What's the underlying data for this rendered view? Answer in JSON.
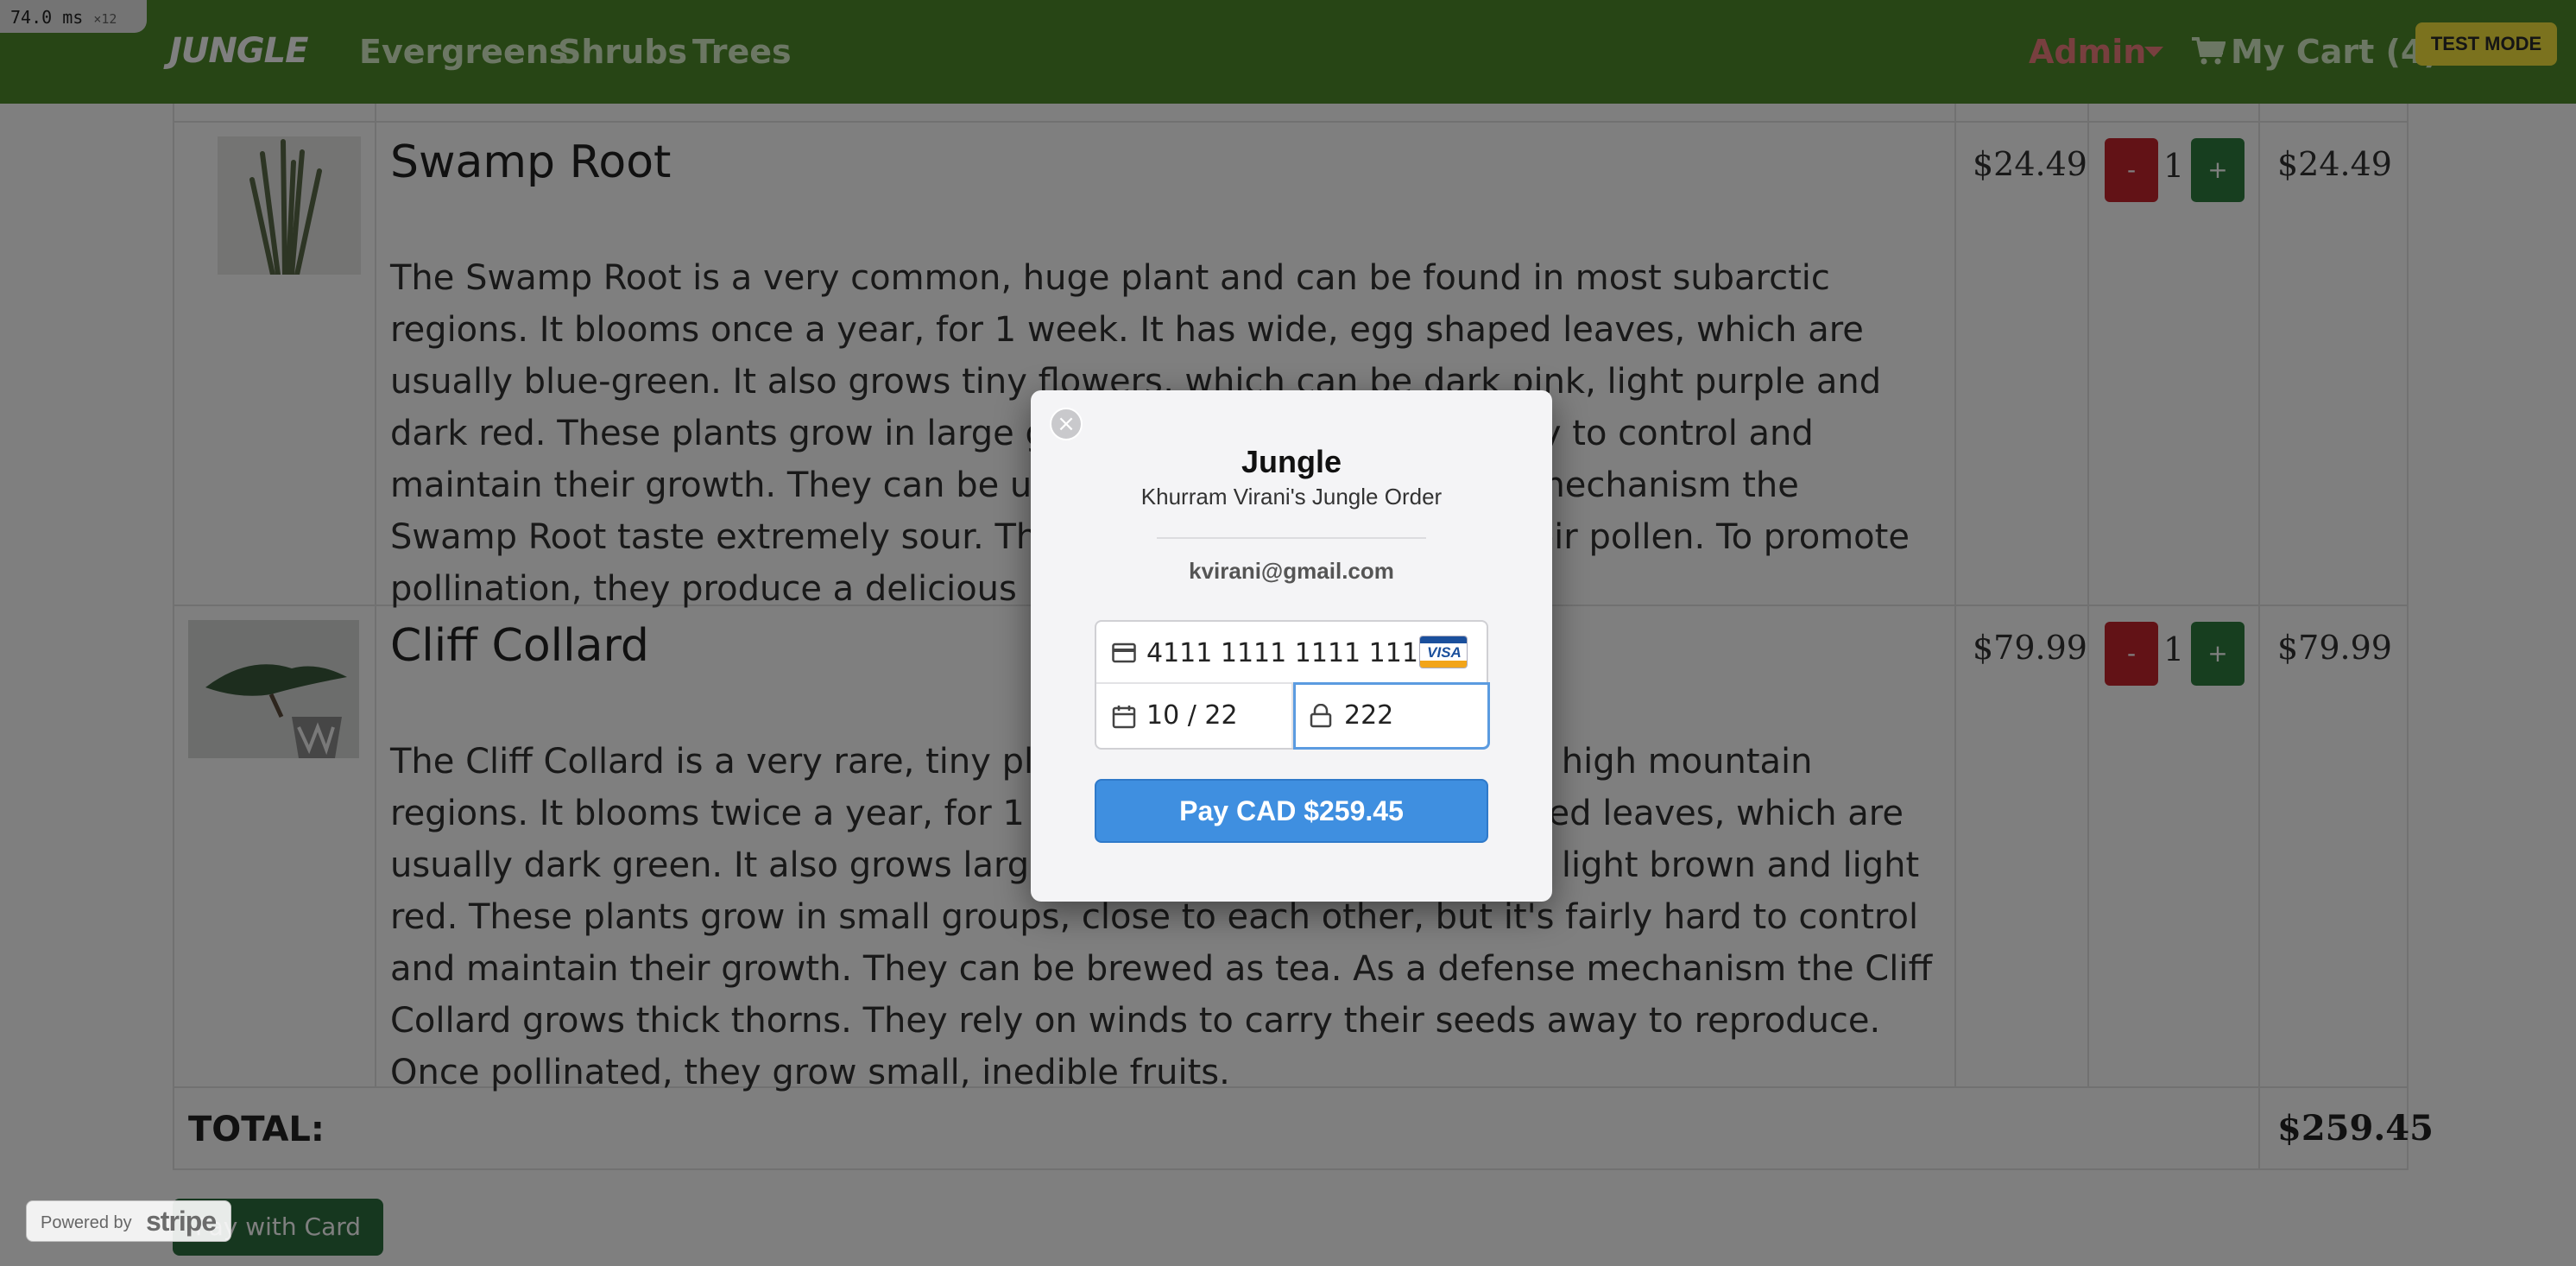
{
  "perf": {
    "value": "74.0",
    "unit": "ms",
    "multiplier": "×12"
  },
  "navbar": {
    "brand": "JUNGLE",
    "links": [
      "Evergreens",
      "Shrubs",
      "Trees"
    ],
    "admin_label": "Admin",
    "cart_label": "My Cart (4)",
    "test_mode": "TEST MODE"
  },
  "cart": {
    "items": [
      {
        "name": "Swamp Root",
        "description": "The Swamp Root is a very common, huge plant and can be found in most subarctic regions. It blooms once a year, for 1 week. It has wide, egg shaped leaves, which are usually blue-green. It also grows tiny flowers, which can be dark pink, light purple and dark red. These plants grow in large groups, but it's extremely easy to control and maintain their growth. They can be used as a spice. As a defense mechanism the Swamp Root taste extremely sour. They rely on insects to carry their pollen. To promote pollination, they produce a delicious nectar.",
        "price": "$24.49",
        "qty": "1",
        "line_total": "$24.49",
        "minus": "-",
        "plus": "+"
      },
      {
        "name": "Cliff Collard",
        "description": "The Cliff Collard is a very rare, tiny plant and can be found in some high mountain regions. It blooms twice a year, for 1 week. It has wide, spear shaped leaves, which are usually dark green. It also grows large flowers, which can be silver, light brown and light red. These plants grow in small groups, close to each other, but it's fairly hard to control and maintain their growth. They can be brewed as tea. As a defense mechanism the Cliff Collard grows thick thorns. They rely on winds to carry their seeds away to reproduce. Once pollinated, they grow small, inedible fruits.",
        "price": "$79.99",
        "qty": "1",
        "line_total": "$79.99",
        "minus": "-",
        "plus": "+"
      }
    ],
    "total_label": "TOTAL:",
    "total_value": "$259.45",
    "pay_button": "Pay with Card"
  },
  "stripe_badge": {
    "powered_by": "Powered by",
    "brand": "stripe"
  },
  "checkout_modal": {
    "title": "Jungle",
    "subtitle": "Khurram Virani's Jungle Order",
    "email": "kvirani@gmail.com",
    "card_number": "4111 1111 1111 1111",
    "card_brand": "VISA",
    "expiry": "10 / 22",
    "cvc": "222",
    "pay_button": "Pay CAD $259.45",
    "close_symbol": "×"
  },
  "colors": {
    "navbar": "#4f8a2b",
    "admin": "#f07f7f",
    "test_mode": "#f7e53c",
    "qty_minus": "#c4242c",
    "qty_plus": "#2e7d3e",
    "pay_button": "#3f8fe0",
    "focus_ring": "#5b9be0"
  }
}
